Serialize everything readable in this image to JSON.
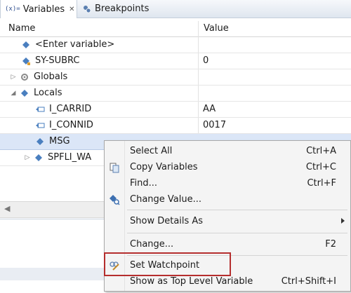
{
  "tabs": {
    "variables": {
      "icon_text": "(x)=",
      "label": "Variables",
      "close": "✕"
    },
    "breakpoints": {
      "label": "Breakpoints"
    }
  },
  "table": {
    "headers": {
      "name": "Name",
      "value": "Value"
    },
    "rows": [
      {
        "name": "<Enter variable>",
        "value": ""
      },
      {
        "name": "SY-SUBRC",
        "value": "0"
      },
      {
        "name": "Globals",
        "value": ""
      },
      {
        "name": "Locals",
        "value": ""
      },
      {
        "name": "I_CARRID",
        "value": "AA"
      },
      {
        "name": "I_CONNID",
        "value": "0017"
      },
      {
        "name": "MSG",
        "value": ""
      },
      {
        "name": "SPFLI_WA",
        "value": ""
      }
    ]
  },
  "context_menu": {
    "items": [
      {
        "label": "Select All",
        "shortcut": "Ctrl+A"
      },
      {
        "label": "Copy Variables",
        "shortcut": "Ctrl+C"
      },
      {
        "label": "Find...",
        "shortcut": "Ctrl+F"
      },
      {
        "label": "Change Value...",
        "shortcut": ""
      },
      {
        "label": "Show Details As",
        "shortcut": ""
      },
      {
        "label": "Change...",
        "shortcut": "F2"
      },
      {
        "label": "Set Watchpoint",
        "shortcut": ""
      },
      {
        "label": "Show as Top Level Variable",
        "shortcut": "Ctrl+Shift+I"
      }
    ]
  },
  "colors": {
    "selection": "#dbe6f7",
    "highlight_border": "#b52e2e",
    "menu_bg": "#f4f4f4"
  }
}
